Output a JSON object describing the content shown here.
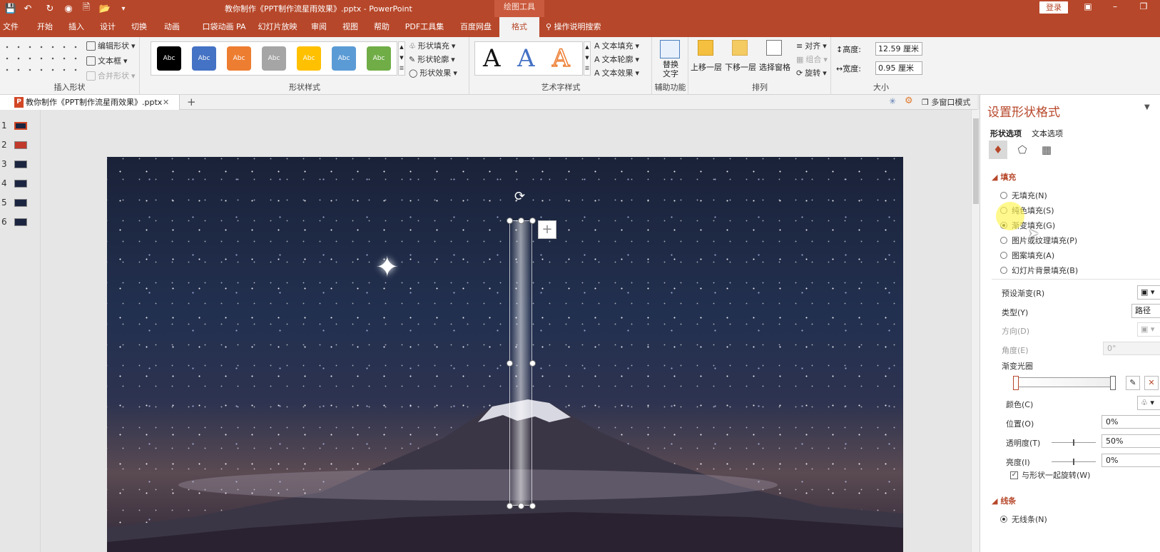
{
  "titlebar": {
    "doc_title": "教你制作《PPT制作流星雨效果》.pptx  -  PowerPoint",
    "context_tool": "绘图工具",
    "login": "登录"
  },
  "tabs": [
    {
      "label": "文件"
    },
    {
      "label": "开始"
    },
    {
      "label": "插入"
    },
    {
      "label": "设计"
    },
    {
      "label": "切换"
    },
    {
      "label": "动画"
    },
    {
      "label": "口袋动画 PA"
    },
    {
      "label": "幻灯片放映"
    },
    {
      "label": "审阅"
    },
    {
      "label": "视图"
    },
    {
      "label": "帮助"
    },
    {
      "label": "PDF工具集"
    },
    {
      "label": "百度网盘"
    },
    {
      "label": "格式"
    }
  ],
  "search_label": "操作说明搜索",
  "ribbon": {
    "insert_shapes": {
      "edit_shape": "编辑形状",
      "text_box": "文本框",
      "merge_shapes": "合并形状",
      "label": "插入形状"
    },
    "shape_styles": {
      "swatch_text": "Abc",
      "swatches": [
        "#000000",
        "#4472c4",
        "#ed7d31",
        "#a5a5a5",
        "#ffc000",
        "#5b9bd5",
        "#70ad47"
      ],
      "fill": "形状填充",
      "outline": "形状轮廓",
      "effects": "形状效果",
      "label": "形状样式"
    },
    "wordart": {
      "letter": "A",
      "text_fill": "文本填充",
      "text_outline": "文本轮廓",
      "text_effects": "文本效果",
      "label": "艺术字样式"
    },
    "accessibility": {
      "alt_text": "替换\n文字",
      "label": "辅助功能"
    },
    "arrange": {
      "bring_forward": "上移一层",
      "send_backward": "下移一层",
      "selection_pane": "选择窗格",
      "align": "对齐",
      "group": "组合",
      "rotate": "旋转",
      "label": "排列"
    },
    "size": {
      "height_label": "高度:",
      "height_value": "12.59 厘米",
      "width_label": "宽度:",
      "width_value": "0.95 厘米",
      "label": "大小"
    }
  },
  "doc_tab": {
    "title": "教你制作《PPT制作流星雨效果》.pptx",
    "multi_window": "多窗口模式"
  },
  "thumbnails": [
    {
      "num": "1"
    },
    {
      "num": "2"
    },
    {
      "num": "3"
    },
    {
      "num": "4"
    },
    {
      "num": "5"
    },
    {
      "num": "6"
    }
  ],
  "pane": {
    "title": "设置形状格式",
    "tab_shape": "形状选项",
    "tab_text": "文本选项",
    "fill_section": "填充",
    "fill_options": [
      {
        "label": "无填充(N)",
        "checked": false
      },
      {
        "label": "纯色填充(S)",
        "checked": false
      },
      {
        "label": "渐变填充(G)",
        "checked": true
      },
      {
        "label": "图片或纹理填充(P)",
        "checked": false
      },
      {
        "label": "图案填充(A)",
        "checked": false
      },
      {
        "label": "幻灯片背景填充(B)",
        "checked": false
      }
    ],
    "preset_gradient": "预设渐变(R)",
    "type_label": "类型(Y)",
    "type_value": "路径",
    "direction": "方向(D)",
    "angle": "角度(E)",
    "angle_value": "0°",
    "gradient_stops": "渐变光圈",
    "color": "颜色(C)",
    "position": "位置(O)",
    "position_value": "0%",
    "transparency": "透明度(T)",
    "transparency_value": "50%",
    "brightness": "亮度(I)",
    "brightness_value": "0%",
    "rotate_with_shape": "与形状一起旋转(W)",
    "line_section": "线条",
    "no_line": "无线条(N)"
  }
}
